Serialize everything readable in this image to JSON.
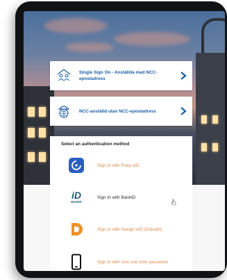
{
  "sso_cards": [
    {
      "label": "Single Sign On - Anställda med NCC-epostadress",
      "icon": "users-network-icon"
    },
    {
      "label": "NCC-anställd utan NCC-epostadress",
      "icon": "globe-hardhat-icon"
    }
  ],
  "auth_panel": {
    "title": "Select an authentication method",
    "methods": [
      {
        "label": "Sign in with Freja eID",
        "icon": "freja-eid-icon"
      },
      {
        "label": "Sign in with BankID",
        "icon": "bankid-icon",
        "icon_text": "iD",
        "icon_caption": "BankID"
      },
      {
        "label": "Sign in with foreign eID (Dokobit)",
        "icon": "dokobit-icon"
      },
      {
        "label": "Sign in with sms one time password",
        "icon": "phone-icon"
      }
    ]
  },
  "colors": {
    "link_blue": "#1a5fa8",
    "method_orange": "#e0894a",
    "freja_blue": "#2b5fbf",
    "dokobit_orange": "#f0902a"
  }
}
